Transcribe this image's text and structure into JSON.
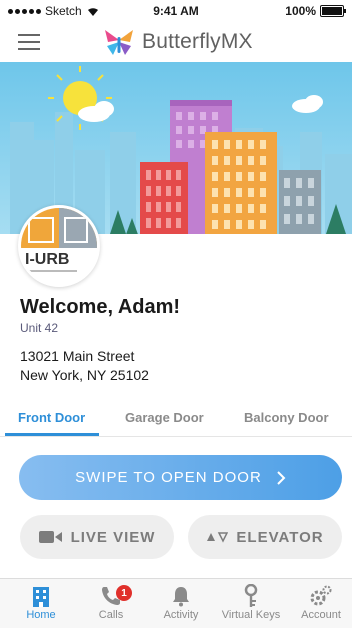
{
  "status_bar": {
    "carrier": "Sketch",
    "time": "9:41 AM",
    "battery": "100%"
  },
  "header": {
    "brand": "ButterflyMX",
    "menu_icon": "hamburger-menu-icon"
  },
  "colors": {
    "accent": "#2e8fd8",
    "badge": "#e0302b"
  },
  "profile": {
    "welcome": "Welcome, Adam!",
    "unit": "Unit 42",
    "address_line1": "13021 Main Street",
    "address_line2": "New York, NY 25102",
    "avatar_text": "I-URB"
  },
  "tabs": [
    {
      "label": "Front Door",
      "active": true
    },
    {
      "label": "Garage Door",
      "active": false
    },
    {
      "label": "Balcony Door",
      "active": false
    }
  ],
  "actions": {
    "swipe_label": "SWIPE TO OPEN DOOR",
    "live_view_label": "LIVE VIEW",
    "elevator_label": "ELEVATOR"
  },
  "bottom_nav": [
    {
      "label": "Home",
      "icon": "building-icon",
      "active": true
    },
    {
      "label": "Calls",
      "icon": "phone-icon",
      "badge": "1"
    },
    {
      "label": "Activity",
      "icon": "bell-icon"
    },
    {
      "label": "Virtual Keys",
      "icon": "key-icon"
    },
    {
      "label": "Account",
      "icon": "gear-icon"
    }
  ]
}
